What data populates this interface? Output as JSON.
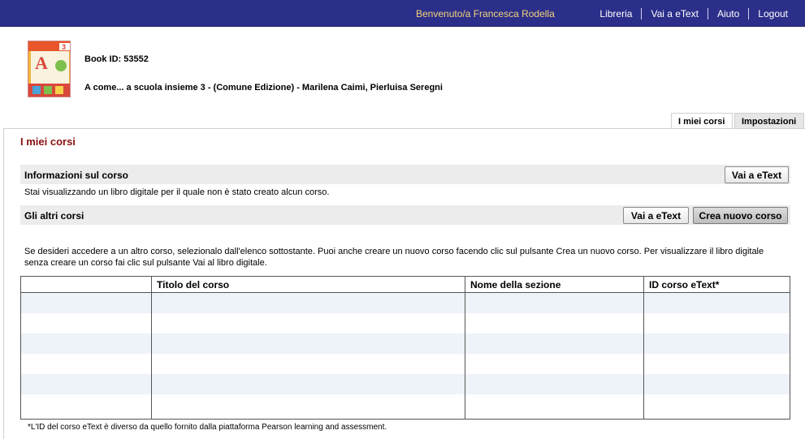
{
  "header": {
    "welcome": "Benvenuto/a Francesca Rodella",
    "nav": [
      "Libreria",
      "Vai a eText",
      "Aiuto",
      "Logout"
    ]
  },
  "book": {
    "id_label": "Book ID: 53552",
    "title": "A come... a scuola insieme 3 - (Comune Edizione) - Marilena Caimi, Pierluisa Seregni",
    "cover_letter": "A",
    "cover_number": "3"
  },
  "tabs": {
    "active": "I miei corsi",
    "inactive": "Impostazioni"
  },
  "panel": {
    "title": "I miei corsi",
    "info_heading": "Informazioni sul corso",
    "info_text": "Stai visualizzando un libro digitale per il quale non è stato creato alcun corso.",
    "info_button": "Vai a eText",
    "other_heading": "Gli altri corsi",
    "other_button_etext": "Vai a eText",
    "other_button_create": "Crea nuovo corso",
    "description": "Se desideri accedere a un altro corso, selezionalo dall'elenco sottostante. Puoi anche creare un nuovo corso facendo clic sul pulsante Crea un nuovo corso. Per visualizzare il libro digitale senza creare un corso fai clic sul pulsante Vai al libro digitale."
  },
  "table": {
    "headers": [
      "",
      "Titolo del corso",
      "Nome della sezione",
      "ID corso eText*"
    ]
  },
  "footnote": "*L'ID del corso eText è diverso da quello fornito dalla piattaforma Pearson learning and assessment.",
  "colors": {
    "topbar": "#2c2f8a",
    "welcome": "#f2d37a",
    "panel_title": "#8b1010",
    "row_alt": "#eef2f9"
  }
}
